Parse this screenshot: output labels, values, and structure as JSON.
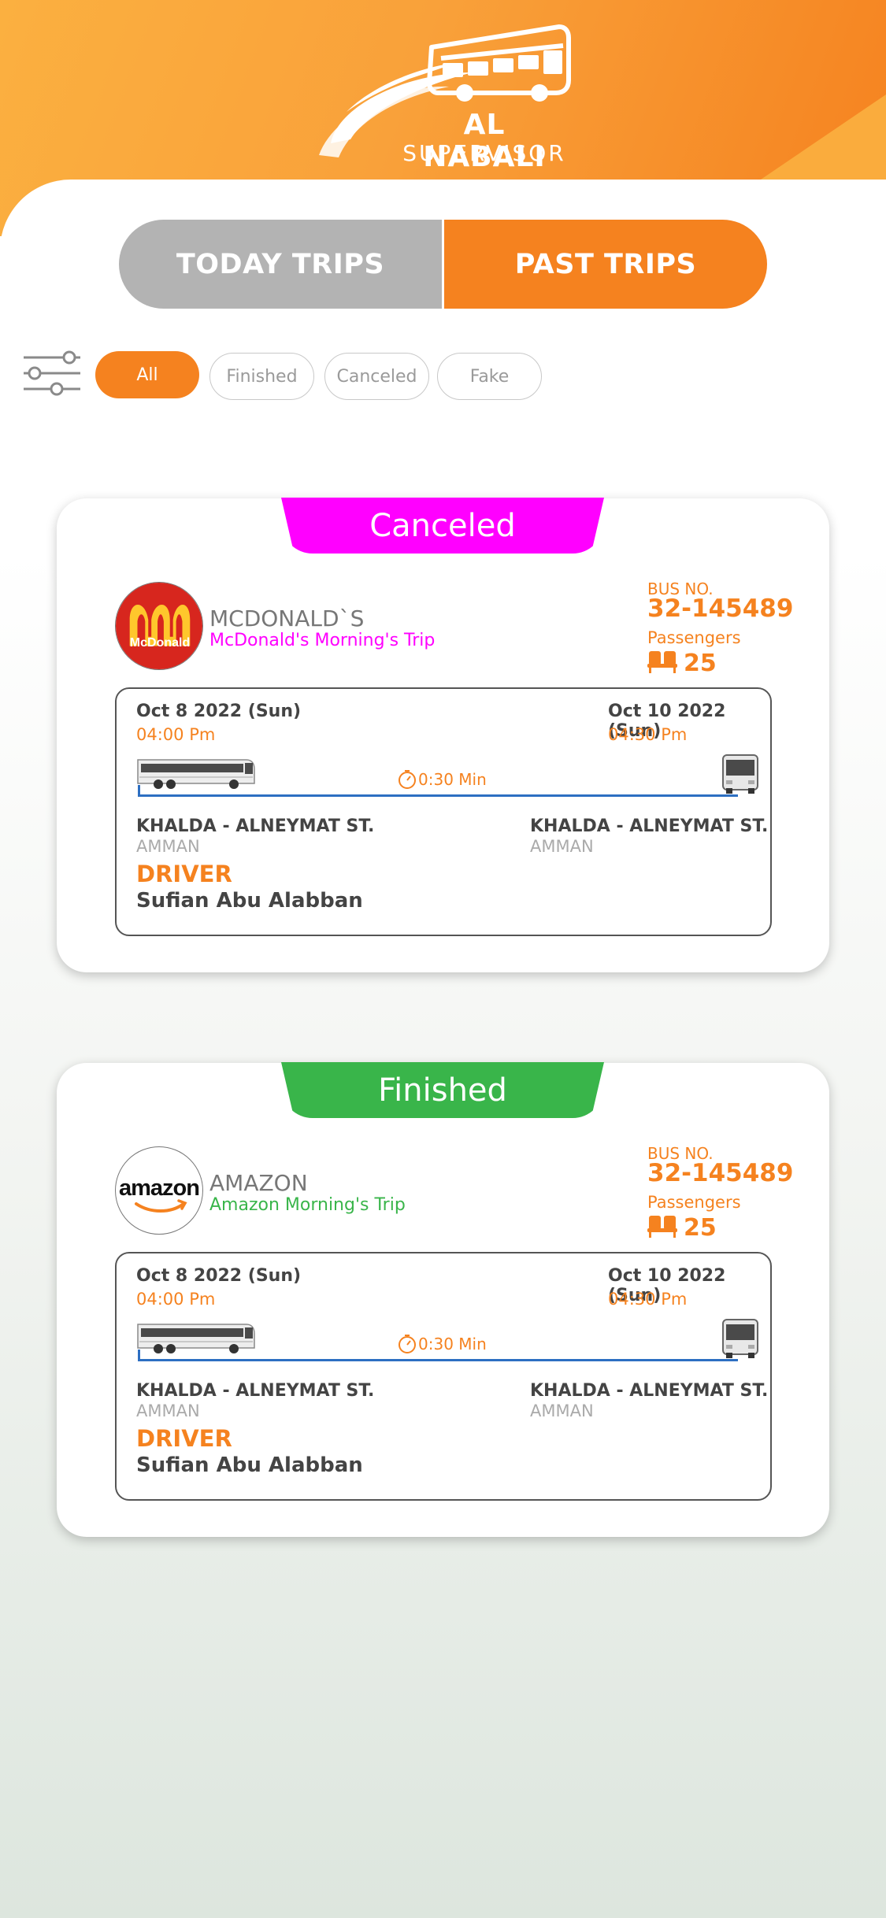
{
  "header": {
    "brand_name": "AL NABALI",
    "brand_sub": "SUPERVISOR",
    "logo_icon": "bus-icon"
  },
  "tabs": [
    {
      "label": "TODAY TRIPS",
      "active": false
    },
    {
      "label": "PAST TRIPS",
      "active": true
    }
  ],
  "filters": {
    "icon": "sliders-icon",
    "chips": [
      {
        "label": "All",
        "active": true
      },
      {
        "label": "Finished",
        "active": false
      },
      {
        "label": "Canceled",
        "active": false
      },
      {
        "label": "Fake",
        "active": false
      }
    ]
  },
  "colors": {
    "accent": "#f5821f",
    "canceled": "#ff00ff",
    "finished": "#39b54a",
    "route_line": "#2d6fc2"
  },
  "trips": [
    {
      "status": "Canceled",
      "status_color": "#ff00ff",
      "company": "MCDONALD`S",
      "logo_text": "McDonald",
      "trip_name": "McDonald's Morning's Trip",
      "bus_label": "BUS NO.",
      "bus_no": "32-145489",
      "passengers_label": "Passengers",
      "passengers": "25",
      "depart_date": "Oct 8 2022 (Sun)",
      "depart_time": "04:00 Pm",
      "arrive_date": "Oct 10 2022 (Sun)",
      "arrive_time": "04:30 Pm",
      "duration": "0:30 Min",
      "from_stop": "KHALDA - ALNEYMAT ST.",
      "from_city": "AMMAN",
      "to_stop": "KHALDA - ALNEYMAT ST.",
      "to_city": "AMMAN",
      "driver_label": "DRIVER",
      "driver_name": "Sufian Abu Alabban"
    },
    {
      "status": "Finished",
      "status_color": "#39b54a",
      "company": "AMAZON",
      "logo_text": "amazon",
      "trip_name": "Amazon Morning's Trip",
      "bus_label": "BUS NO.",
      "bus_no": "32-145489",
      "passengers_label": "Passengers",
      "passengers": "25",
      "depart_date": "Oct 8 2022 (Sun)",
      "depart_time": "04:00 Pm",
      "arrive_date": "Oct 10 2022 (Sun)",
      "arrive_time": "04:30 Pm",
      "duration": "0:30 Min",
      "from_stop": "KHALDA - ALNEYMAT ST.",
      "from_city": "AMMAN",
      "to_stop": "KHALDA - ALNEYMAT ST.",
      "to_city": "AMMAN",
      "driver_label": "DRIVER",
      "driver_name": "Sufian Abu Alabban"
    }
  ]
}
